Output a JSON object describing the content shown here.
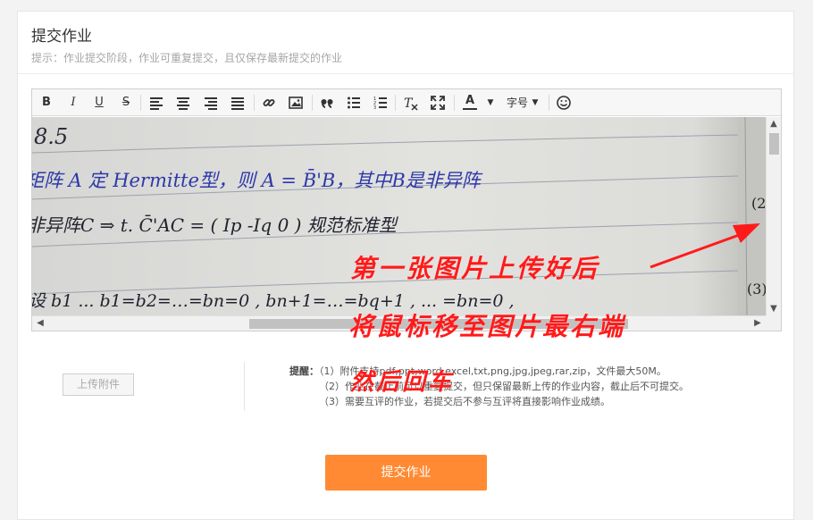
{
  "header": {
    "title": "提交作业",
    "hint": "提示：作业提交阶段，作业可重复提交，且仅保存最新提交的作业"
  },
  "toolbar": {
    "bold": "B",
    "italic": "I",
    "underline": "U",
    "strike": "S",
    "font_color": "A",
    "font_size": "字号"
  },
  "content": {
    "handwriting": {
      "line1": "8.5",
      "line2": "矩阵 A 定 Hermitte型，则 A = B̄'B，其中B是非异阵",
      "line3": "非异阵C ⇒ t. C̄'AC = ( Ip  -Iq  0 )  规范标准型",
      "line4": "设 b1 ... b1=b2=…=bn=0 ,  bn+1=…=bq+1 , ... =bn=0 ,",
      "margin1": "(2",
      "margin2": "(3)"
    }
  },
  "attachment": {
    "upload_label": "上传附件",
    "reminder_label": "提醒：",
    "tips": [
      "（1）附件支持pdf,ppt,word,excel,txt,png,jpg,jpeg,rar,zip，文件最大50M。",
      "（2）作业在截止前可以重复提交，但只保留最新上传的作业内容，截止后不可提交。",
      "（3）需要互评的作业，若提交后不参与互评将直接影响作业成绩。"
    ]
  },
  "submit": {
    "label": "提交作业"
  },
  "annotation": {
    "line1": "第一张图片上传好后",
    "line2": "将鼠标移至图片最右端",
    "line3": "然后回车"
  },
  "colors": {
    "submit_bg": "#ff8a33",
    "annotation": "#ff1a1a"
  }
}
